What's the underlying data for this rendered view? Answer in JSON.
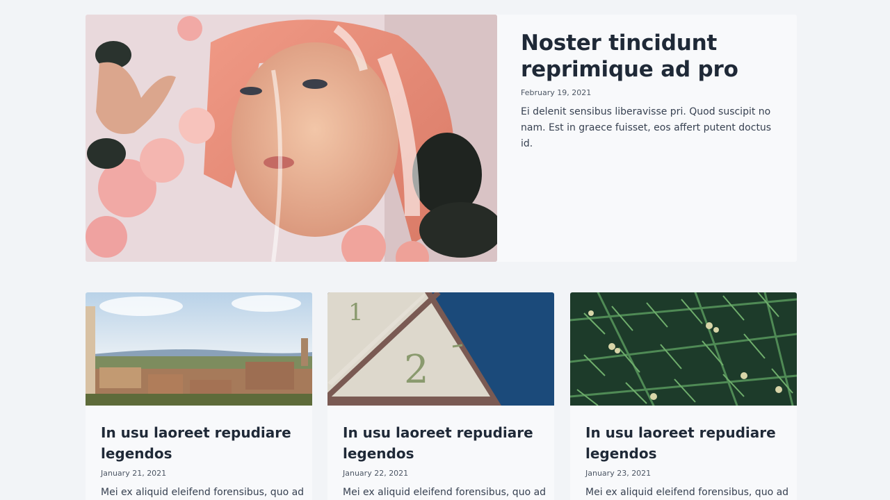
{
  "featured": {
    "title": "Noster tincidunt reprimique ad pro",
    "date": "February 19, 2021",
    "excerpt": "Ei delenit sensibus liberavisse pri. Quod suscipit no nam. Est in graece fuisset, eos affert putent doctus id."
  },
  "cards": [
    {
      "title": "In usu laoreet repudiare legendos",
      "date": "January 21, 2021",
      "excerpt": "Mei ex aliquid eleifend forensibus, quo ad"
    },
    {
      "title": "In usu laoreet repudiare legendos",
      "date": "January 22, 2021",
      "excerpt": "Mei ex aliquid eleifend forensibus, quo ad"
    },
    {
      "title": "In usu laoreet repudiare legendos",
      "date": "January 23, 2021",
      "excerpt": "Mei ex aliquid eleifend forensibus, quo ad"
    }
  ],
  "icons": {
    "featured_image": "portrait-photo",
    "card_images": [
      "town-landscape-photo",
      "clock-face-photo",
      "pine-branches-photo"
    ]
  },
  "colors": {
    "background": "#f2f4f7",
    "card": "#f8f9fb",
    "text": "#1f2937"
  }
}
